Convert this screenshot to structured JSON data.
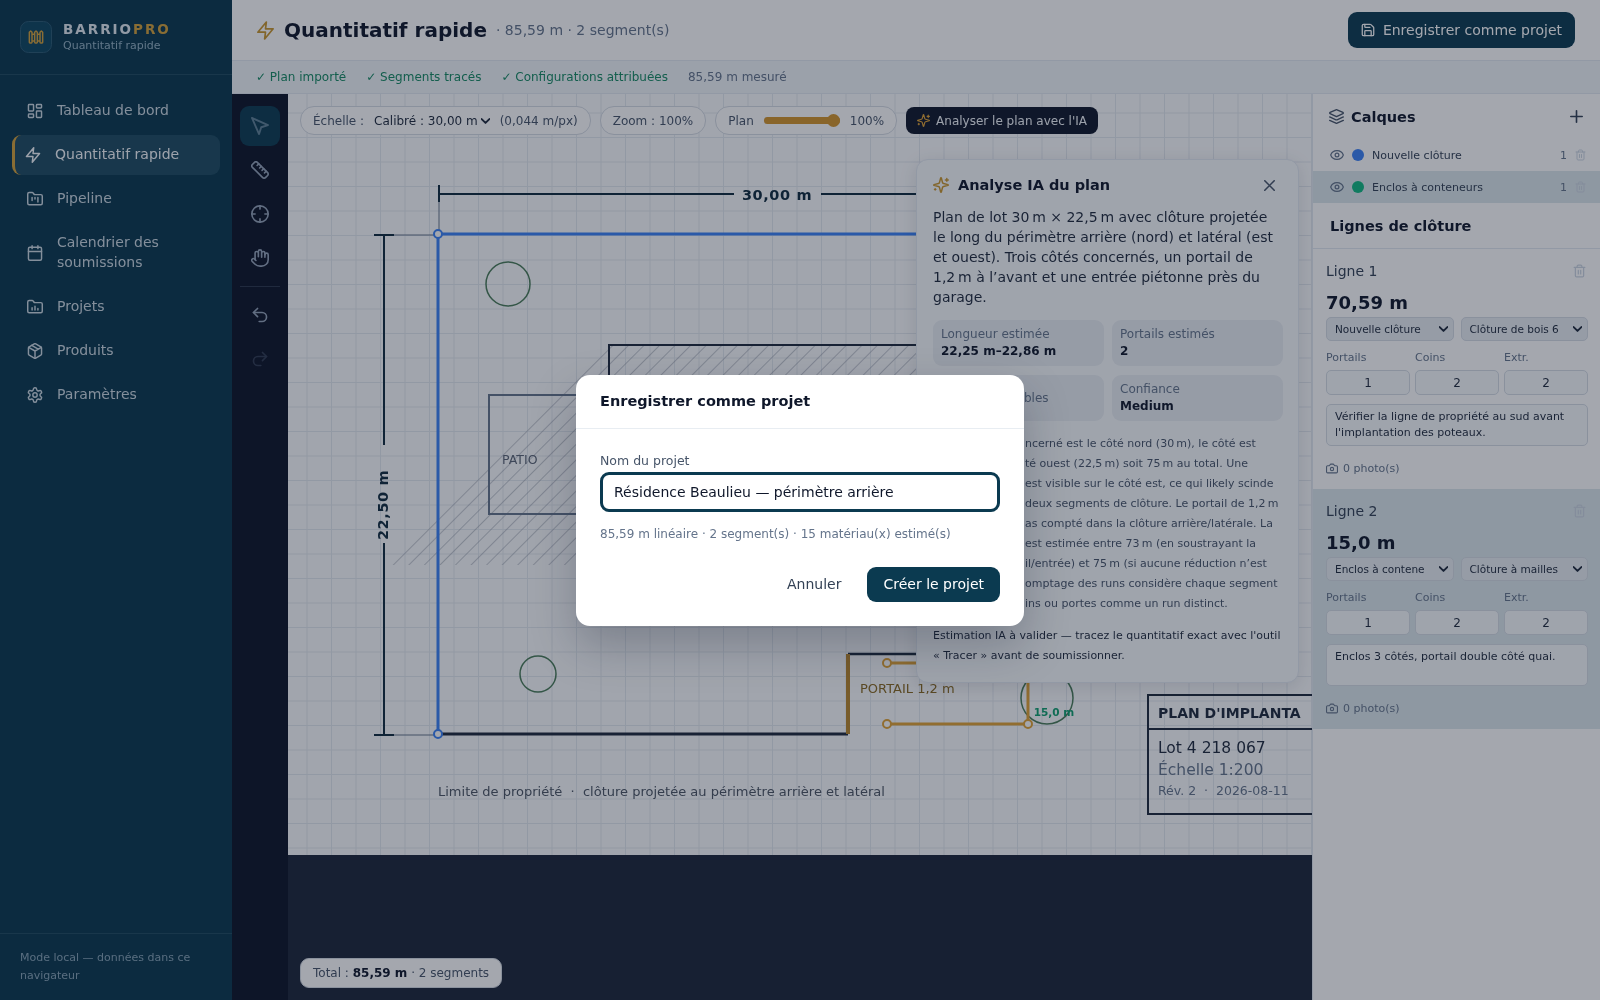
{
  "sidebar": {
    "brand": {
      "name": "BARRIO",
      "accent": "PRO",
      "subtitle": "Quantitatif rapide"
    },
    "items": [
      {
        "label": "Tableau de bord",
        "selected": false
      },
      {
        "label": "Quantitatif rapide",
        "selected": true
      },
      {
        "label": "Pipeline",
        "selected": false
      },
      {
        "label": "Calendrier des soumissions",
        "selected": false
      },
      {
        "label": "Projets",
        "selected": false
      },
      {
        "label": "Produits",
        "selected": false
      },
      {
        "label": "Paramètres",
        "selected": false
      }
    ],
    "footer": "Mode local — données dans ce navigateur"
  },
  "header": {
    "title": "Quantitatif rapide",
    "summary": "· 85,59 m · 2 segment(s)",
    "save_button": "Enregistrer comme projet"
  },
  "steps": [
    {
      "label": "✓ Plan importé",
      "done": true
    },
    {
      "label": "✓ Segments tracés",
      "done": true
    },
    {
      "label": "✓ Configurations attribuées",
      "done": true
    },
    {
      "label": "85,59 m mesuré",
      "done": false
    }
  ],
  "tools": [
    {
      "selected": true
    },
    {
      "selected": false
    },
    {
      "selected": false
    },
    {
      "selected": false
    }
  ],
  "history": [
    {
      "disabled": false
    },
    {
      "disabled": true
    }
  ],
  "toolbar": {
    "scale_label": "Échelle :",
    "scale_value": "Calibré : 30,00 m",
    "scale_ratio": "(0,044 m/px)",
    "zoom": "Zoom : 100%",
    "plan_label": "Plan",
    "plan_opacity": {
      "level": 1,
      "reading": "100%"
    },
    "analyze_button": "Analyser le plan avec l'IA"
  },
  "canvas": {
    "top_dimension": "30,00 m",
    "left_dimension": "22,50 m",
    "patio_label": "PATIO",
    "gate_label": "PORTAIL 1,2 m",
    "segment_length": "15,0 m",
    "caption": "Limite de propriété  ·  clôture projetée au périmètre arrière et latéral",
    "title_block": {
      "title": "PLAN D'IMPLANTA",
      "lot": "Lot 4 218 067",
      "scale": "Échelle 1:200",
      "revision": "Rév. 2  ·  2026-08-11"
    }
  },
  "ai_analysis": {
    "title": "Analyse IA du plan",
    "summary": "Plan de lot 30 m × 22,5 m avec clôture projetée le long du périmètre arrière (nord) et latéral (est et ouest). Trois côtés concernés, un portail de 1,2 m à l’avant et une entrée piétonne près du garage.",
    "stats": [
      {
        "label": "Longueur estimée",
        "value": "22,25 m–22,86 m"
      },
      {
        "label": "Portails estimés",
        "value": "2"
      },
      {
        "label": "bles"
      },
      {
        "label": "Confiance",
        "value": "Medium"
      }
    ],
    "detail_lines": [
      "ncerné est le côté nord (30 m), le côté est",
      "té ouest (22,5 m) soit 75 m au total. Une",
      "est visible sur le côté est, ce qui likely scinde",
      "deux segments de clôture. Le portail de 1,2 m",
      "as compté dans la clôture arrière/latérale. La",
      "est estimée entre 73 m (en soustrayant la",
      "il/entrée) et 75 m (si aucune réduction n’est",
      "omptage des runs considère chaque segment",
      "ins ou portes comme un run distinct."
    ],
    "note": "Estimation IA à valider — tracez le quantitatif exact avec l'outil « Tracer » avant de soumissionner."
  },
  "layers": {
    "title": "Calques",
    "items": [
      {
        "name": "Nouvelle clôture",
        "color": "#2a59a8",
        "count": "1",
        "selected": false
      },
      {
        "name": "Enclos à conteneurs",
        "color": "#107b60",
        "count": "1",
        "selected": true
      }
    ]
  },
  "fence_lines": {
    "title": "Lignes de clôture",
    "items": [
      {
        "title": "Ligne 1",
        "length": "70,59 m",
        "layer": "Nouvelle clôture",
        "product": "Clôture de bois 6",
        "fields": [
          {
            "label": "Portails",
            "value": "1"
          },
          {
            "label": "Coins",
            "value": "2"
          },
          {
            "label": "Extr.",
            "value": "2"
          }
        ],
        "note": "Vérifier la ligne de propriété au sud avant l'implantation des poteaux.",
        "photos": "0 photo(s)",
        "selected": false
      },
      {
        "title": "Ligne 2",
        "length": "15,0 m",
        "layer": "Enclos à contene",
        "product": "Clôture à mailles",
        "fields": [
          {
            "label": "Portails",
            "value": "1"
          },
          {
            "label": "Coins",
            "value": "2"
          },
          {
            "label": "Extr.",
            "value": "2"
          }
        ],
        "note": "Enclos 3 côtés, portail double côté quai.",
        "photos": "0 photo(s)",
        "selected": true
      }
    ]
  },
  "total": "Total : **85,59 m** · 2 segments",
  "dialog": {
    "title": "Enregistrer comme projet",
    "field_label": "Nom du projet",
    "value": "Résidence Beaulieu — périmètre arrière",
    "hint": "85,59 m linéaire · 2 segment(s) · 15 matériau(x) estimé(s)",
    "cancel": "Annuler",
    "confirm": "Créer le projet"
  }
}
